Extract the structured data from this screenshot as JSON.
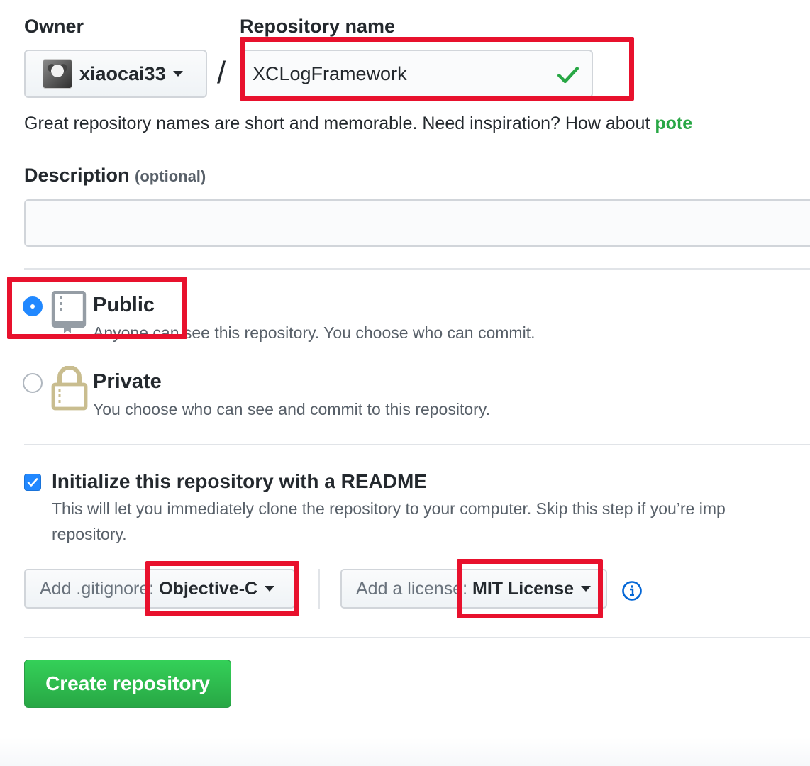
{
  "owner": {
    "label": "Owner",
    "selected": "xiaocai33"
  },
  "separator": "/",
  "repository": {
    "label": "Repository name",
    "value": "XCLogFramework",
    "valid_color": "#28a745"
  },
  "name_hint": {
    "text": "Great repository names are short and memorable. Need inspiration? How about ",
    "suggestion": "pote"
  },
  "description": {
    "label": "Description",
    "optional": "(optional)",
    "value": ""
  },
  "visibility": {
    "public": {
      "title": "Public",
      "note_obscured": "Anyone can",
      "note": " see this repository. You choose who can commit.",
      "selected": true
    },
    "private": {
      "title": "Private",
      "note": "You choose who can see and commit to this repository.",
      "selected": false
    }
  },
  "readme": {
    "checked": true,
    "title": "Initialize this repository with a README",
    "note_line1": "This will let you immediately clone the repository to your computer. Skip this step if you’re imp",
    "note_line2": "repository."
  },
  "gitignore": {
    "prefix": "Add .gitignore:",
    "value": "Objective-C"
  },
  "license": {
    "prefix": "Add a license:",
    "value": "MIT License"
  },
  "create_button": "Create repository",
  "colors": {
    "accent_blue": "#2188ff",
    "create_green": "#28a745",
    "highlight_red": "#e8112d"
  }
}
